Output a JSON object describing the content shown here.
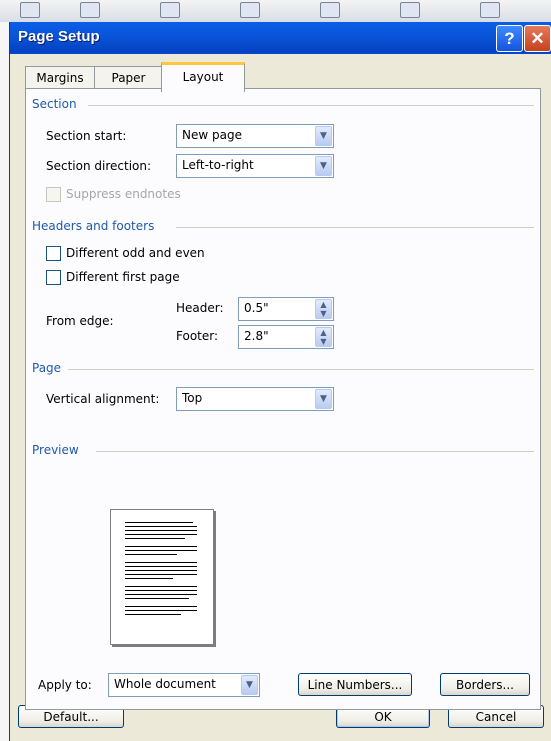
{
  "dialog": {
    "title": "Page Setup",
    "help_glyph": "?",
    "close_glyph": "✕"
  },
  "tabs": [
    {
      "label": "Margins",
      "selected": false
    },
    {
      "label": "Paper",
      "selected": false
    },
    {
      "label": "Layout",
      "selected": true
    }
  ],
  "section": {
    "heading": "Section",
    "start_label": "Section start:",
    "start_value": "New page",
    "direction_label": "Section direction:",
    "direction_value": "Left-to-right",
    "suppress_label": "Suppress endnotes",
    "suppress_checked": false,
    "suppress_enabled": false
  },
  "headers_footers": {
    "heading": "Headers and footers",
    "odd_even_label": "Different odd and even",
    "odd_even_checked": false,
    "first_page_label": "Different first page",
    "first_page_checked": false,
    "from_edge_label": "From edge:",
    "header_label": "Header:",
    "header_value": "0.5\"",
    "footer_label": "Footer:",
    "footer_value": "2.8\""
  },
  "page": {
    "heading": "Page",
    "valign_label": "Vertical alignment:",
    "valign_value": "Top"
  },
  "preview": {
    "heading": "Preview",
    "apply_label": "Apply to:",
    "apply_value": "Whole document",
    "line_numbers_button": "Line Numbers...",
    "borders_button": "Borders..."
  },
  "footer_buttons": {
    "default": "Default...",
    "ok": "OK",
    "cancel": "Cancel"
  },
  "colors": {
    "titlebar": "#0a54d8",
    "group_heading": "#1f5aa8",
    "tab_highlight": "#ffc83c"
  }
}
